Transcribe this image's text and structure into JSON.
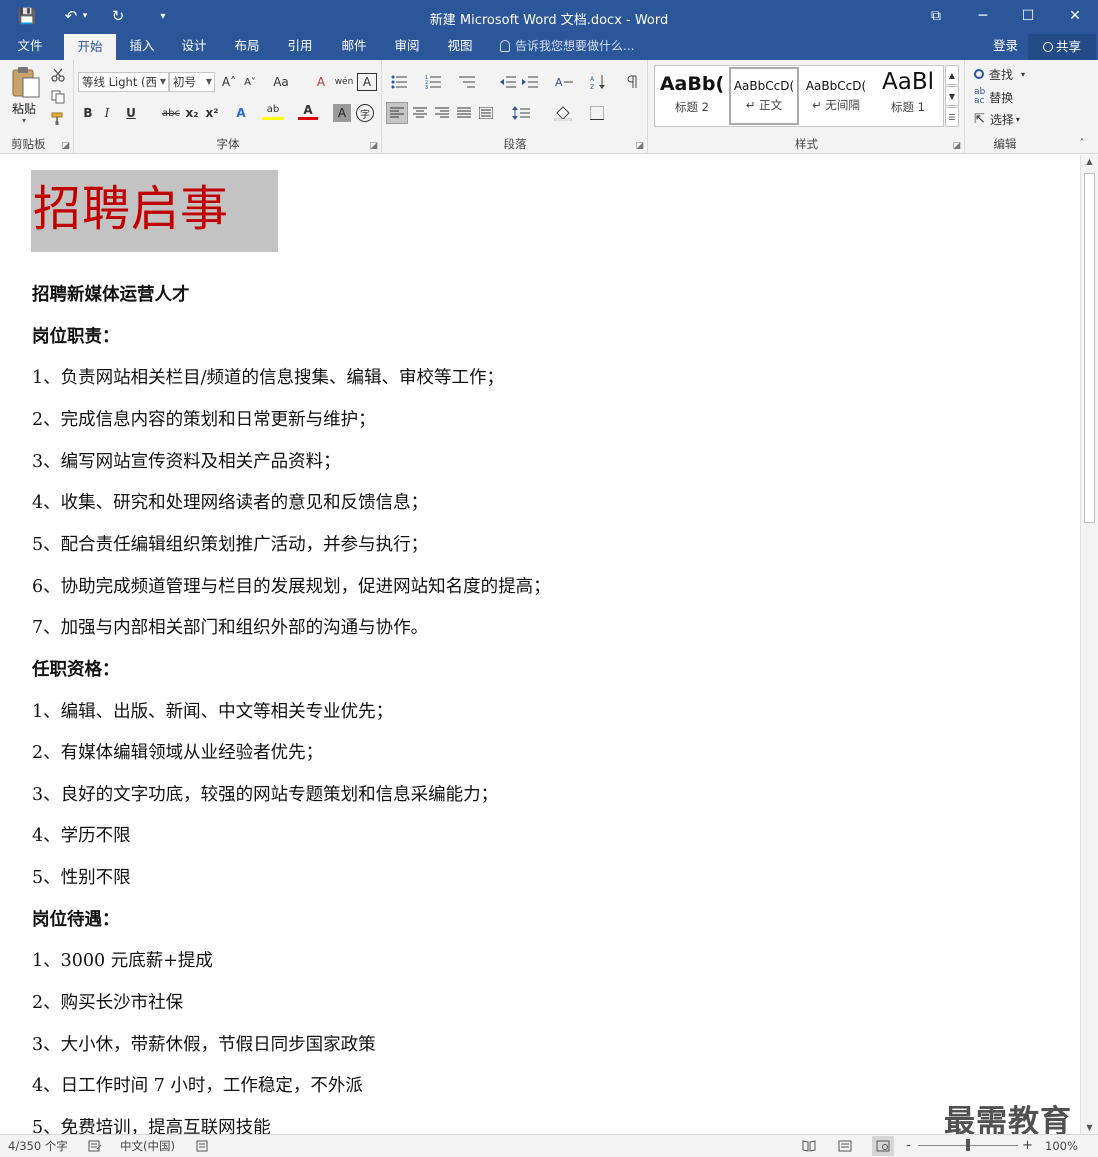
{
  "titlebar": {
    "title": "新建 Microsoft Word 文档.docx - Word",
    "save_icon": "💾",
    "undo_icon": "↶",
    "undo_arrow": "▾",
    "redo_icon": "↻",
    "customize_icon": "▾",
    "ribbon_display_icon": "⧉",
    "minimize_icon": "─",
    "maximize_icon": "☐",
    "close_icon": "✕"
  },
  "tabs": [
    "文件",
    "开始",
    "插入",
    "设计",
    "布局",
    "引用",
    "邮件",
    "审阅",
    "视图"
  ],
  "active_tab": "开始",
  "tellme": "告诉我您想要做什么...",
  "login": "登录",
  "share": "共享",
  "ribbon": {
    "clipboard": {
      "label": "剪贴板",
      "paste": "粘贴",
      "paste_arrow": "▾"
    },
    "font": {
      "label": "字体",
      "font_name": "等线 Light (西",
      "font_size": "初号",
      "grow": "A˄",
      "shrink": "A˅",
      "case": "Aa",
      "clear_format": "A",
      "pinyin": "wén",
      "border_char": "A",
      "bold": "B",
      "italic": "I",
      "underline": "U",
      "strike": "abc",
      "subscript": "x₂",
      "superscript": "x²",
      "text_effect": "A",
      "highlight": "ab",
      "font_color": "A",
      "char_shading": "A",
      "enclose": "字"
    },
    "paragraph": {
      "label": "段落"
    },
    "styles": {
      "label": "样式",
      "items": [
        {
          "preview": "AaBb(",
          "name": "标题 2"
        },
        {
          "preview": "AaBbCcD(",
          "name": "↵ 正文"
        },
        {
          "preview": "AaBbCcD(",
          "name": "↵ 无间隔"
        },
        {
          "preview": "AaBl",
          "name": "标题 1"
        }
      ]
    },
    "editing": {
      "label": "编辑",
      "find": "查找",
      "replace": "替换",
      "select": "选择"
    }
  },
  "document": {
    "title": "招聘启事",
    "paragraphs": [
      {
        "text": "招聘新媒体运营人才",
        "bold": true
      },
      {
        "text": "岗位职责：",
        "bold": true
      },
      {
        "text": "1、负责网站相关栏目/频道的信息搜集、编辑、审校等工作；",
        "bold": false
      },
      {
        "text": "2、完成信息内容的策划和日常更新与维护；",
        "bold": false
      },
      {
        "text": "3、编写网站宣传资料及相关产品资料；",
        "bold": false
      },
      {
        "text": "4、收集、研究和处理网络读者的意见和反馈信息；",
        "bold": false
      },
      {
        "text": "5、配合责任编辑组织策划推广活动，并参与执行；",
        "bold": false
      },
      {
        "text": "6、协助完成频道管理与栏目的发展规划，促进网站知名度的提高；",
        "bold": false
      },
      {
        "text": "7、加强与内部相关部门和组织外部的沟通与协作。",
        "bold": false
      },
      {
        "text": "任职资格：",
        "bold": true
      },
      {
        "text": "1、编辑、出版、新闻、中文等相关专业优先；",
        "bold": false
      },
      {
        "text": "2、有媒体编辑领域从业经验者优先；",
        "bold": false
      },
      {
        "text": "3、良好的文字功底，较强的网站专题策划和信息采编能力；",
        "bold": false
      },
      {
        "text": "4、学历不限",
        "bold": false
      },
      {
        "text": "5、性别不限",
        "bold": false
      },
      {
        "text": "岗位待遇：",
        "bold": true
      },
      {
        "text": "1、3000 元底薪+提成",
        "bold": false
      },
      {
        "text": "2、购买长沙市社保",
        "bold": false
      },
      {
        "text": "3、大小休，带薪休假，节假日同步国家政策",
        "bold": false
      },
      {
        "text": "4、日工作时间 7 小时，工作稳定，不外派",
        "bold": false
      },
      {
        "text": "5、免费培训，提高互联网技能",
        "bold": false
      }
    ]
  },
  "status": {
    "page": "4/350 个字",
    "language": "中文(中国)",
    "zoom_minus": "-",
    "zoom_plus": "+",
    "zoom": "100%",
    "zoom_fraction": 0.5
  },
  "watermark": "最需教育"
}
